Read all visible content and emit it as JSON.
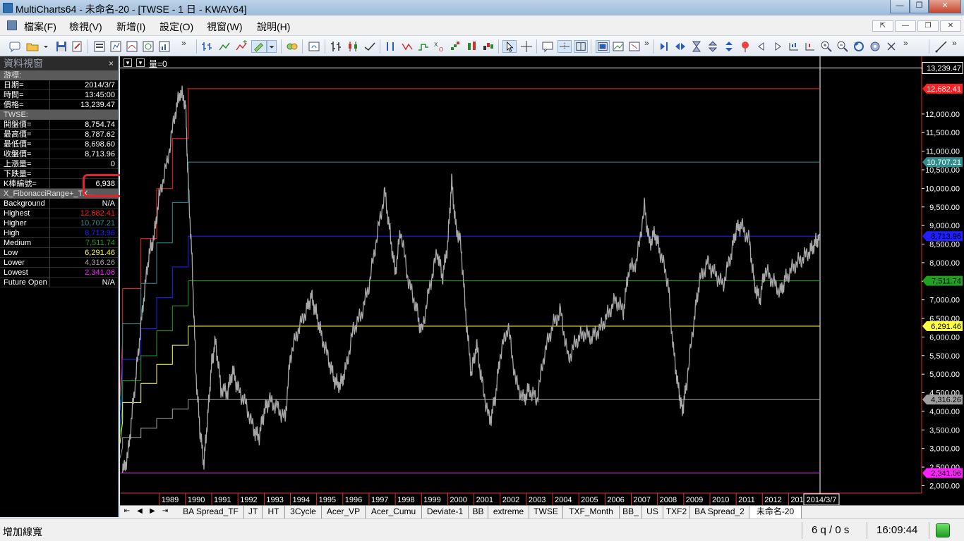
{
  "window": {
    "title": "MultiCharts64 - 未命名-20 - [TWSE - 1 日 - KWAY64]",
    "min_glyph": "—",
    "max_glyph": "❐",
    "close_glyph": "✕"
  },
  "menu": {
    "items": [
      "檔案(F)",
      "檢視(V)",
      "新增(I)",
      "設定(O)",
      "視窗(W)",
      "說明(H)"
    ],
    "mdi_buttons": [
      "⇱",
      "—",
      "❐",
      "✕"
    ]
  },
  "toolbar": {
    "overflow_glyph": "»"
  },
  "data_window": {
    "title": "資料視窗",
    "close_glyph": "×",
    "cursor_group": "游標:",
    "cursor_rows": [
      {
        "label": "日期=",
        "value": "2014/3/7"
      },
      {
        "label": "時間=",
        "value": "13:45:00"
      },
      {
        "label": "價格=",
        "value": "13,239.47"
      }
    ],
    "symbol_group": "TWSE:",
    "symbol_rows": [
      {
        "label": "開盤價=",
        "value": "8,754.74"
      },
      {
        "label": "最高價=",
        "value": "8,787.62"
      },
      {
        "label": "最低價=",
        "value": "8,698.60"
      },
      {
        "label": "收盤價=",
        "value": "8,713.96"
      },
      {
        "label": "上漲量=",
        "value": "0"
      },
      {
        "label": "下跌量=",
        "value": ""
      },
      {
        "label": "K棒編號=",
        "value": "6,938"
      }
    ],
    "indicator_group": "X_FibonacciRange+_TX...",
    "indicator_rows": [
      {
        "label": "Background",
        "value": "N/A",
        "color": "#ffffff"
      },
      {
        "label": "Highest",
        "value": "12,682.41",
        "color": "#ff2020"
      },
      {
        "label": "Higher",
        "value": "10,707.21",
        "color": "#2f8f8f"
      },
      {
        "label": "High",
        "value": "8,713.96",
        "color": "#2020ff"
      },
      {
        "label": "Medium",
        "value": "7,511.74",
        "color": "#20a020"
      },
      {
        "label": "Low",
        "value": "6,291.46",
        "color": "#ffff40"
      },
      {
        "label": "Lower",
        "value": "4,316.26",
        "color": "#a0a0a0"
      },
      {
        "label": "Lowest",
        "value": "2,341.06",
        "color": "#ff20ff"
      },
      {
        "label": "Future Open",
        "value": "N/A",
        "color": "#ffffff"
      }
    ]
  },
  "chart_header": {
    "dropdown_glyph": "▾",
    "volume_label": "量=0"
  },
  "chart_data": {
    "type": "line",
    "series_color": "#a8a8a8",
    "cursor_price": 13239.47,
    "cursor_price_label": "13,239.47",
    "ylim": [
      1800,
      13400
    ],
    "y_ticks": [
      2000,
      2500,
      3000,
      3500,
      4000,
      4500,
      5000,
      5500,
      6000,
      6500,
      7000,
      7500,
      8000,
      8500,
      9000,
      9500,
      10000,
      10500,
      11000,
      11500,
      12000
    ],
    "y_tick_labels": [
      "2,000.00",
      "2,500.00",
      "3,000.00",
      "3,500.00",
      "4,000.00",
      "4,500.00",
      "5,000.00",
      "5,500.00",
      "6,000.00",
      "6,500.00",
      "7,000.00",
      "7,500.00",
      "8,000.00",
      "8,500.00",
      "9,000.00",
      "9,500.00",
      "10,000.00",
      "10,500.00",
      "11,000.00",
      "11,500.00",
      "12,000.00"
    ],
    "x_years": [
      "1989",
      "1990",
      "1991",
      "1992",
      "1993",
      "1994",
      "1995",
      "1996",
      "1997",
      "1998",
      "1999",
      "2000",
      "2001",
      "2002",
      "2003",
      "2004",
      "2005",
      "2006",
      "2007",
      "2008",
      "2009",
      "2010",
      "2011",
      "2012",
      "2013"
    ],
    "x_last_label": "2014/3/7",
    "x_range": [
      1987.5,
      2014.2
    ],
    "levels": [
      {
        "name": "Highest",
        "value": 12682.41,
        "label": "12,682.41",
        "color": "#ff2020",
        "text_color": "#ffffff"
      },
      {
        "name": "Higher",
        "value": 10707.21,
        "label": "10,707.21",
        "color": "#2f8f8f",
        "text_color": "#ffffff"
      },
      {
        "name": "High",
        "value": 8713.96,
        "label": "8,713.96",
        "color": "#2020ff",
        "text_color": "#000000"
      },
      {
        "name": "Medium",
        "value": 7511.74,
        "label": "7,511.74",
        "color": "#20a020",
        "text_color": "#000000"
      },
      {
        "name": "Low",
        "value": 6291.46,
        "label": "6,291.46",
        "color": "#ffff40",
        "text_color": "#000000"
      },
      {
        "name": "Lower",
        "value": 4316.26,
        "label": "4,316.26",
        "color": "#a0a0a0",
        "text_color": "#000000"
      },
      {
        "name": "Lowest",
        "value": 2341.06,
        "label": "2,341.06",
        "color": "#ff20ff",
        "text_color": "#000000"
      }
    ],
    "price_path": [
      [
        1987.6,
        2350
      ],
      [
        1987.8,
        2800
      ],
      [
        1988.0,
        4200
      ],
      [
        1988.2,
        5600
      ],
      [
        1988.4,
        7000
      ],
      [
        1988.6,
        8200
      ],
      [
        1988.8,
        8700
      ],
      [
        1989.0,
        9800
      ],
      [
        1989.3,
        10700
      ],
      [
        1989.6,
        12000
      ],
      [
        1989.8,
        12600
      ],
      [
        1990.0,
        12300
      ],
      [
        1990.1,
        10200
      ],
      [
        1990.25,
        8000
      ],
      [
        1990.4,
        5000
      ],
      [
        1990.55,
        3500
      ],
      [
        1990.7,
        2600
      ],
      [
        1990.85,
        3900
      ],
      [
        1991.0,
        5300
      ],
      [
        1991.15,
        5900
      ],
      [
        1991.35,
        4600
      ],
      [
        1991.6,
        4500
      ],
      [
        1991.8,
        5100
      ],
      [
        1992.0,
        4600
      ],
      [
        1992.3,
        4200
      ],
      [
        1992.6,
        3500
      ],
      [
        1992.8,
        3300
      ],
      [
        1993.0,
        4000
      ],
      [
        1993.2,
        4300
      ],
      [
        1993.5,
        4100
      ],
      [
        1993.8,
        3800
      ],
      [
        1994.0,
        5500
      ],
      [
        1994.3,
        6200
      ],
      [
        1994.6,
        6700
      ],
      [
        1994.8,
        7100
      ],
      [
        1995.0,
        6600
      ],
      [
        1995.2,
        6000
      ],
      [
        1995.5,
        5300
      ],
      [
        1995.7,
        4800
      ],
      [
        1995.9,
        4700
      ],
      [
        1996.1,
        5100
      ],
      [
        1996.4,
        6200
      ],
      [
        1996.7,
        6600
      ],
      [
        1997.0,
        7400
      ],
      [
        1997.3,
        8700
      ],
      [
        1997.6,
        9900
      ],
      [
        1997.8,
        8800
      ],
      [
        1998.0,
        7700
      ],
      [
        1998.2,
        8900
      ],
      [
        1998.5,
        7500
      ],
      [
        1998.8,
        6800
      ],
      [
        1999.0,
        6100
      ],
      [
        1999.3,
        7300
      ],
      [
        1999.6,
        8300
      ],
      [
        1999.8,
        7600
      ],
      [
        2000.0,
        8500
      ],
      [
        2000.15,
        10200
      ],
      [
        2000.3,
        9000
      ],
      [
        2000.5,
        8500
      ],
      [
        2000.7,
        6500
      ],
      [
        2000.9,
        5000
      ],
      [
        2001.1,
        5800
      ],
      [
        2001.3,
        4800
      ],
      [
        2001.6,
        3700
      ],
      [
        2001.8,
        4300
      ],
      [
        2002.0,
        5500
      ],
      [
        2002.3,
        6300
      ],
      [
        2002.6,
        4800
      ],
      [
        2002.9,
        4300
      ],
      [
        2003.1,
        4600
      ],
      [
        2003.4,
        4300
      ],
      [
        2003.7,
        5600
      ],
      [
        2004.0,
        6300
      ],
      [
        2004.3,
        6700
      ],
      [
        2004.6,
        5400
      ],
      [
        2004.9,
        5900
      ],
      [
        2005.2,
        6100
      ],
      [
        2005.5,
        6000
      ],
      [
        2005.8,
        6200
      ],
      [
        2006.1,
        6600
      ],
      [
        2006.4,
        7000
      ],
      [
        2006.7,
        6700
      ],
      [
        2006.9,
        7800
      ],
      [
        2007.2,
        8000
      ],
      [
        2007.5,
        9500
      ],
      [
        2007.7,
        8500
      ],
      [
        2007.9,
        8800
      ],
      [
        2008.1,
        8300
      ],
      [
        2008.4,
        7500
      ],
      [
        2008.6,
        5700
      ],
      [
        2008.8,
        4600
      ],
      [
        2008.95,
        4000
      ],
      [
        2009.1,
        4700
      ],
      [
        2009.4,
        6500
      ],
      [
        2009.6,
        7500
      ],
      [
        2009.9,
        8000
      ],
      [
        2010.2,
        7700
      ],
      [
        2010.5,
        7400
      ],
      [
        2010.8,
        8200
      ],
      [
        2011.0,
        8900
      ],
      [
        2011.2,
        9000
      ],
      [
        2011.5,
        8600
      ],
      [
        2011.7,
        7400
      ],
      [
        2011.9,
        7000
      ],
      [
        2012.1,
        7800
      ],
      [
        2012.4,
        7500
      ],
      [
        2012.7,
        7200
      ],
      [
        2012.9,
        7600
      ],
      [
        2013.2,
        7900
      ],
      [
        2013.5,
        8100
      ],
      [
        2013.8,
        8300
      ],
      [
        2014.0,
        8500
      ],
      [
        2014.18,
        8714
      ]
    ]
  },
  "tabs": {
    "nav": [
      "⇤",
      "◀",
      "▶",
      "⇥"
    ],
    "items": [
      "BA Spread_TF",
      "JT",
      "HT",
      "3Cycle",
      "Acer_VP",
      "Acer_Cumu",
      "Deviate-1",
      "BB",
      "extreme",
      "TWSE",
      "TXF_Month",
      "BB_",
      "US",
      "TXF2",
      "BA Spread_2",
      "未命名-20"
    ],
    "active_index": 15
  },
  "status": {
    "hint": "增加線寬",
    "queue": "6 q / 0 s",
    "time": "16:09:44"
  }
}
